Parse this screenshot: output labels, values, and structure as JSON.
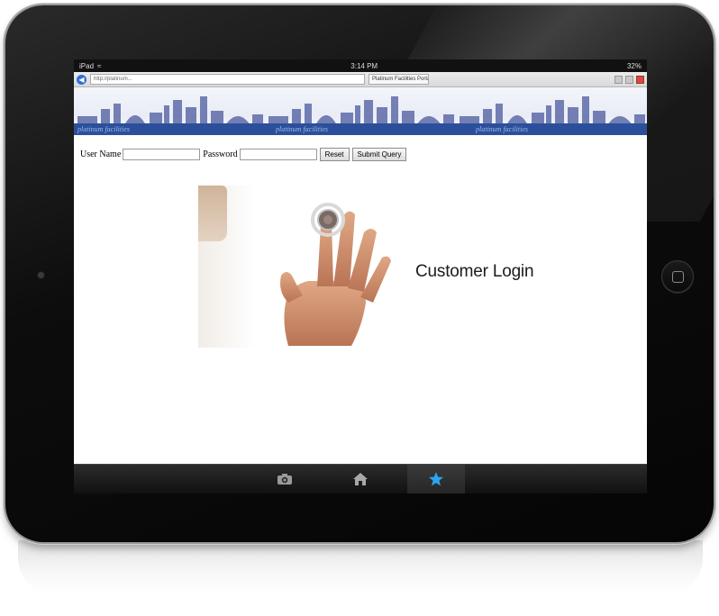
{
  "device": {
    "type": "iPad",
    "status_bar": {
      "carrier": "iPad",
      "time": "3:14 PM",
      "battery": "32%"
    }
  },
  "browser": {
    "address": "http://platinum...",
    "tab_title": "Platinum Facilities Portal"
  },
  "banner": {
    "texts": [
      "platinum facilities",
      "platinum facilities",
      "platinum facilities"
    ],
    "colors": {
      "skyline": "#5e6ba8",
      "strip": "#2b4f9a"
    }
  },
  "login": {
    "username_label": "User Name",
    "password_label": "Password",
    "reset_label": "Reset",
    "submit_label": "Submit Query"
  },
  "main": {
    "heading": "Customer Login"
  },
  "dock": {
    "items": [
      {
        "icon": "camera-icon",
        "active": false
      },
      {
        "icon": "home-icon",
        "active": false
      },
      {
        "icon": "star-icon",
        "active": true
      }
    ],
    "accent": "#2da4ef"
  }
}
